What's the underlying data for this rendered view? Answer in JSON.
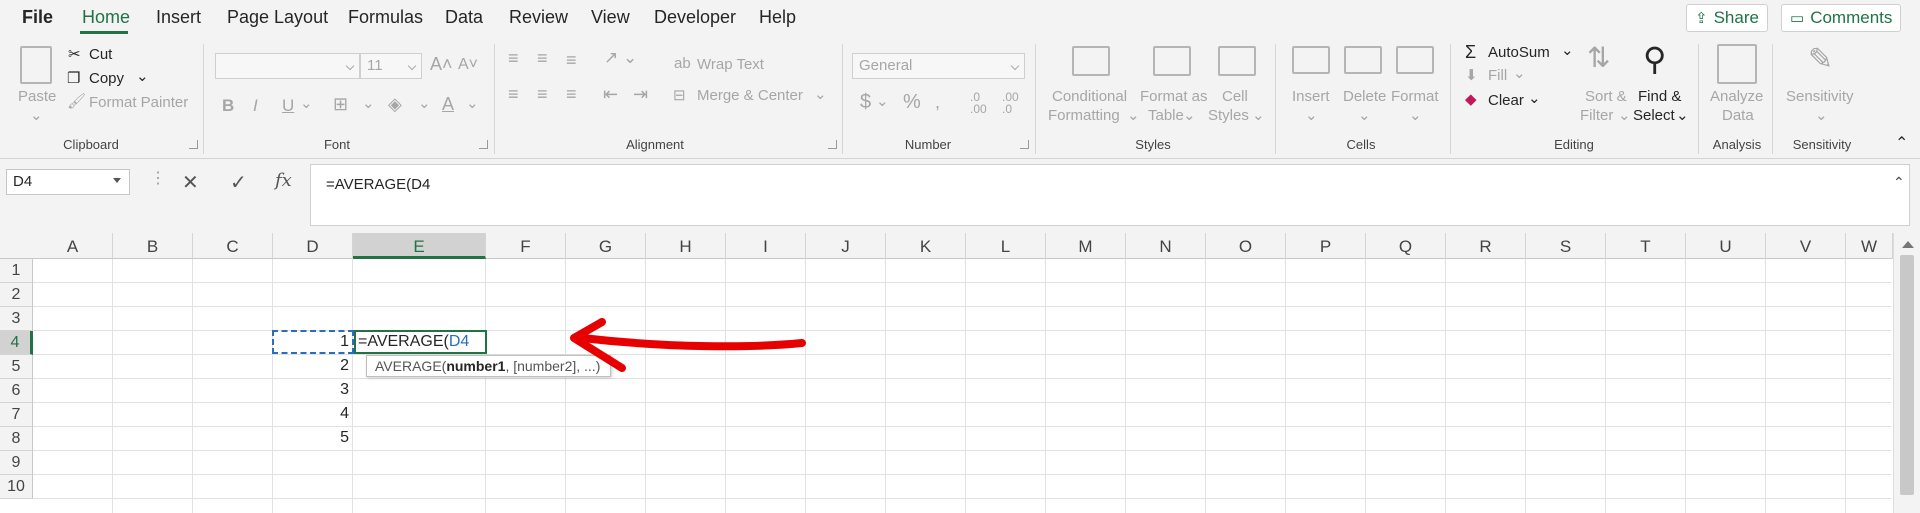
{
  "menu": {
    "file": "File",
    "home": "Home",
    "insert": "Insert",
    "page_layout": "Page Layout",
    "formulas": "Formulas",
    "data": "Data",
    "review": "Review",
    "view": "View",
    "developer": "Developer",
    "help": "Help",
    "share": "Share",
    "comments": "Comments"
  },
  "ribbon": {
    "clipboard": {
      "label": "Clipboard",
      "paste": "Paste",
      "cut": "Cut",
      "copy": "Copy",
      "format_painter": "Format Painter"
    },
    "font": {
      "label": "Font",
      "font_name": "",
      "font_size": "11",
      "bold": "B",
      "italic": "I",
      "underline": "U"
    },
    "alignment": {
      "label": "Alignment",
      "wrap_text": "Wrap Text",
      "merge_center": "Merge & Center"
    },
    "number": {
      "label": "Number",
      "format": "General",
      "currency": "$",
      "percent": "%"
    },
    "styles": {
      "label": "Styles",
      "conditional_1": "Conditional",
      "conditional_2": "Formatting",
      "format_as_1": "Format as",
      "format_as_2": "Table",
      "cell_styles_1": "Cell",
      "cell_styles_2": "Styles"
    },
    "cells": {
      "label": "Cells",
      "insert": "Insert",
      "delete": "Delete",
      "format": "Format"
    },
    "editing": {
      "label": "Editing",
      "autosum": "AutoSum",
      "fill": "Fill",
      "clear": "Clear",
      "sort_1": "Sort &",
      "sort_2": "Filter",
      "find_1": "Find &",
      "find_2": "Select"
    },
    "analysis": {
      "label": "Analysis",
      "analyze_1": "Analyze",
      "analyze_2": "Data"
    },
    "sensitivity": {
      "label": "Sensitivity",
      "button": "Sensitivity"
    }
  },
  "formula_bar": {
    "name_box": "D4",
    "cancel": "✕",
    "enter": "✓",
    "fx": "fx",
    "formula": "=AVERAGE(D4"
  },
  "grid": {
    "columns": [
      "A",
      "B",
      "C",
      "D",
      "E",
      "F",
      "G",
      "H",
      "I",
      "J",
      "K",
      "L",
      "M",
      "N",
      "O",
      "P",
      "Q",
      "R",
      "S",
      "T",
      "U",
      "V",
      "W"
    ],
    "rows": [
      "1",
      "2",
      "3",
      "4",
      "5",
      "6",
      "7",
      "8",
      "9",
      "10"
    ],
    "selected_column": "E",
    "selected_row": "4",
    "d_values": [
      "1",
      "2",
      "3",
      "4",
      "5"
    ],
    "active_cell": {
      "prefix": "=AVERAGE(",
      "ref": "D4"
    },
    "tooltip": {
      "fn": "AVERAGE(",
      "arg1": "number1",
      "rest": ", [number2], ...)"
    }
  },
  "colors": {
    "accent": "#217346",
    "reference": "#2a6ebb",
    "annotation_arrow": "#e60000"
  }
}
